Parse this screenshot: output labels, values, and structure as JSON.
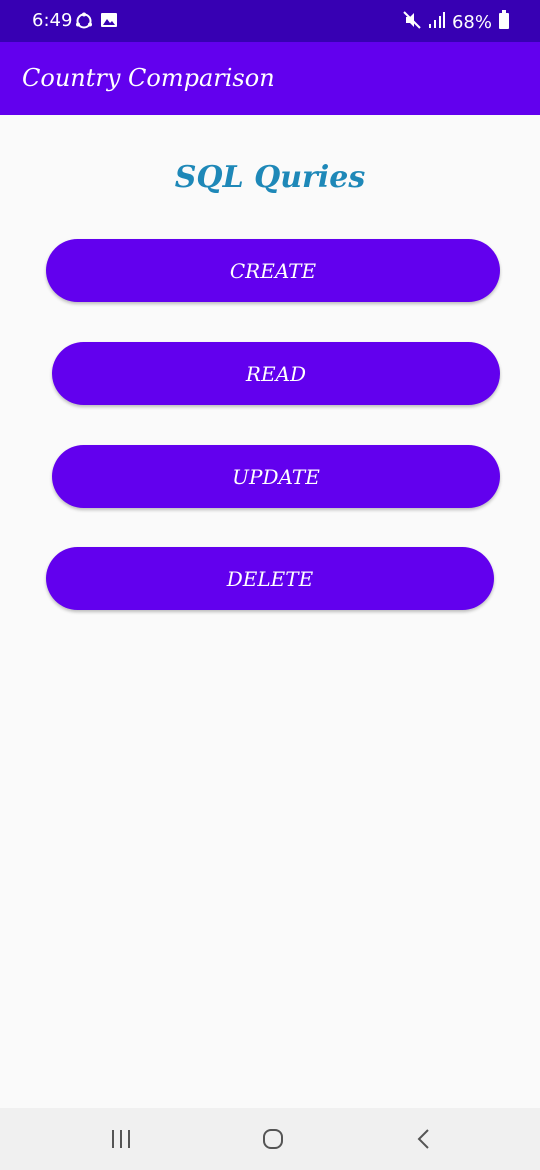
{
  "status_bar": {
    "time": "6:49",
    "battery": "68%",
    "icons_left": [
      "sync-icon",
      "image-icon"
    ],
    "icons_right": [
      "mute-icon",
      "signal-icon",
      "battery-icon"
    ]
  },
  "app_bar": {
    "title": "Country Comparison"
  },
  "main": {
    "heading": "SQL Quries",
    "buttons": {
      "create": "CREATE",
      "read": "READ",
      "update": "UPDATE",
      "delete": "DELETE"
    }
  },
  "nav_bar": {
    "icons": [
      "recents-icon",
      "home-icon",
      "back-icon"
    ]
  },
  "colors": {
    "status_bar": "#3700b3",
    "app_bar": "#6200ee",
    "button": "#6200ee",
    "heading": "#1e88b8",
    "background": "#fafafa"
  }
}
